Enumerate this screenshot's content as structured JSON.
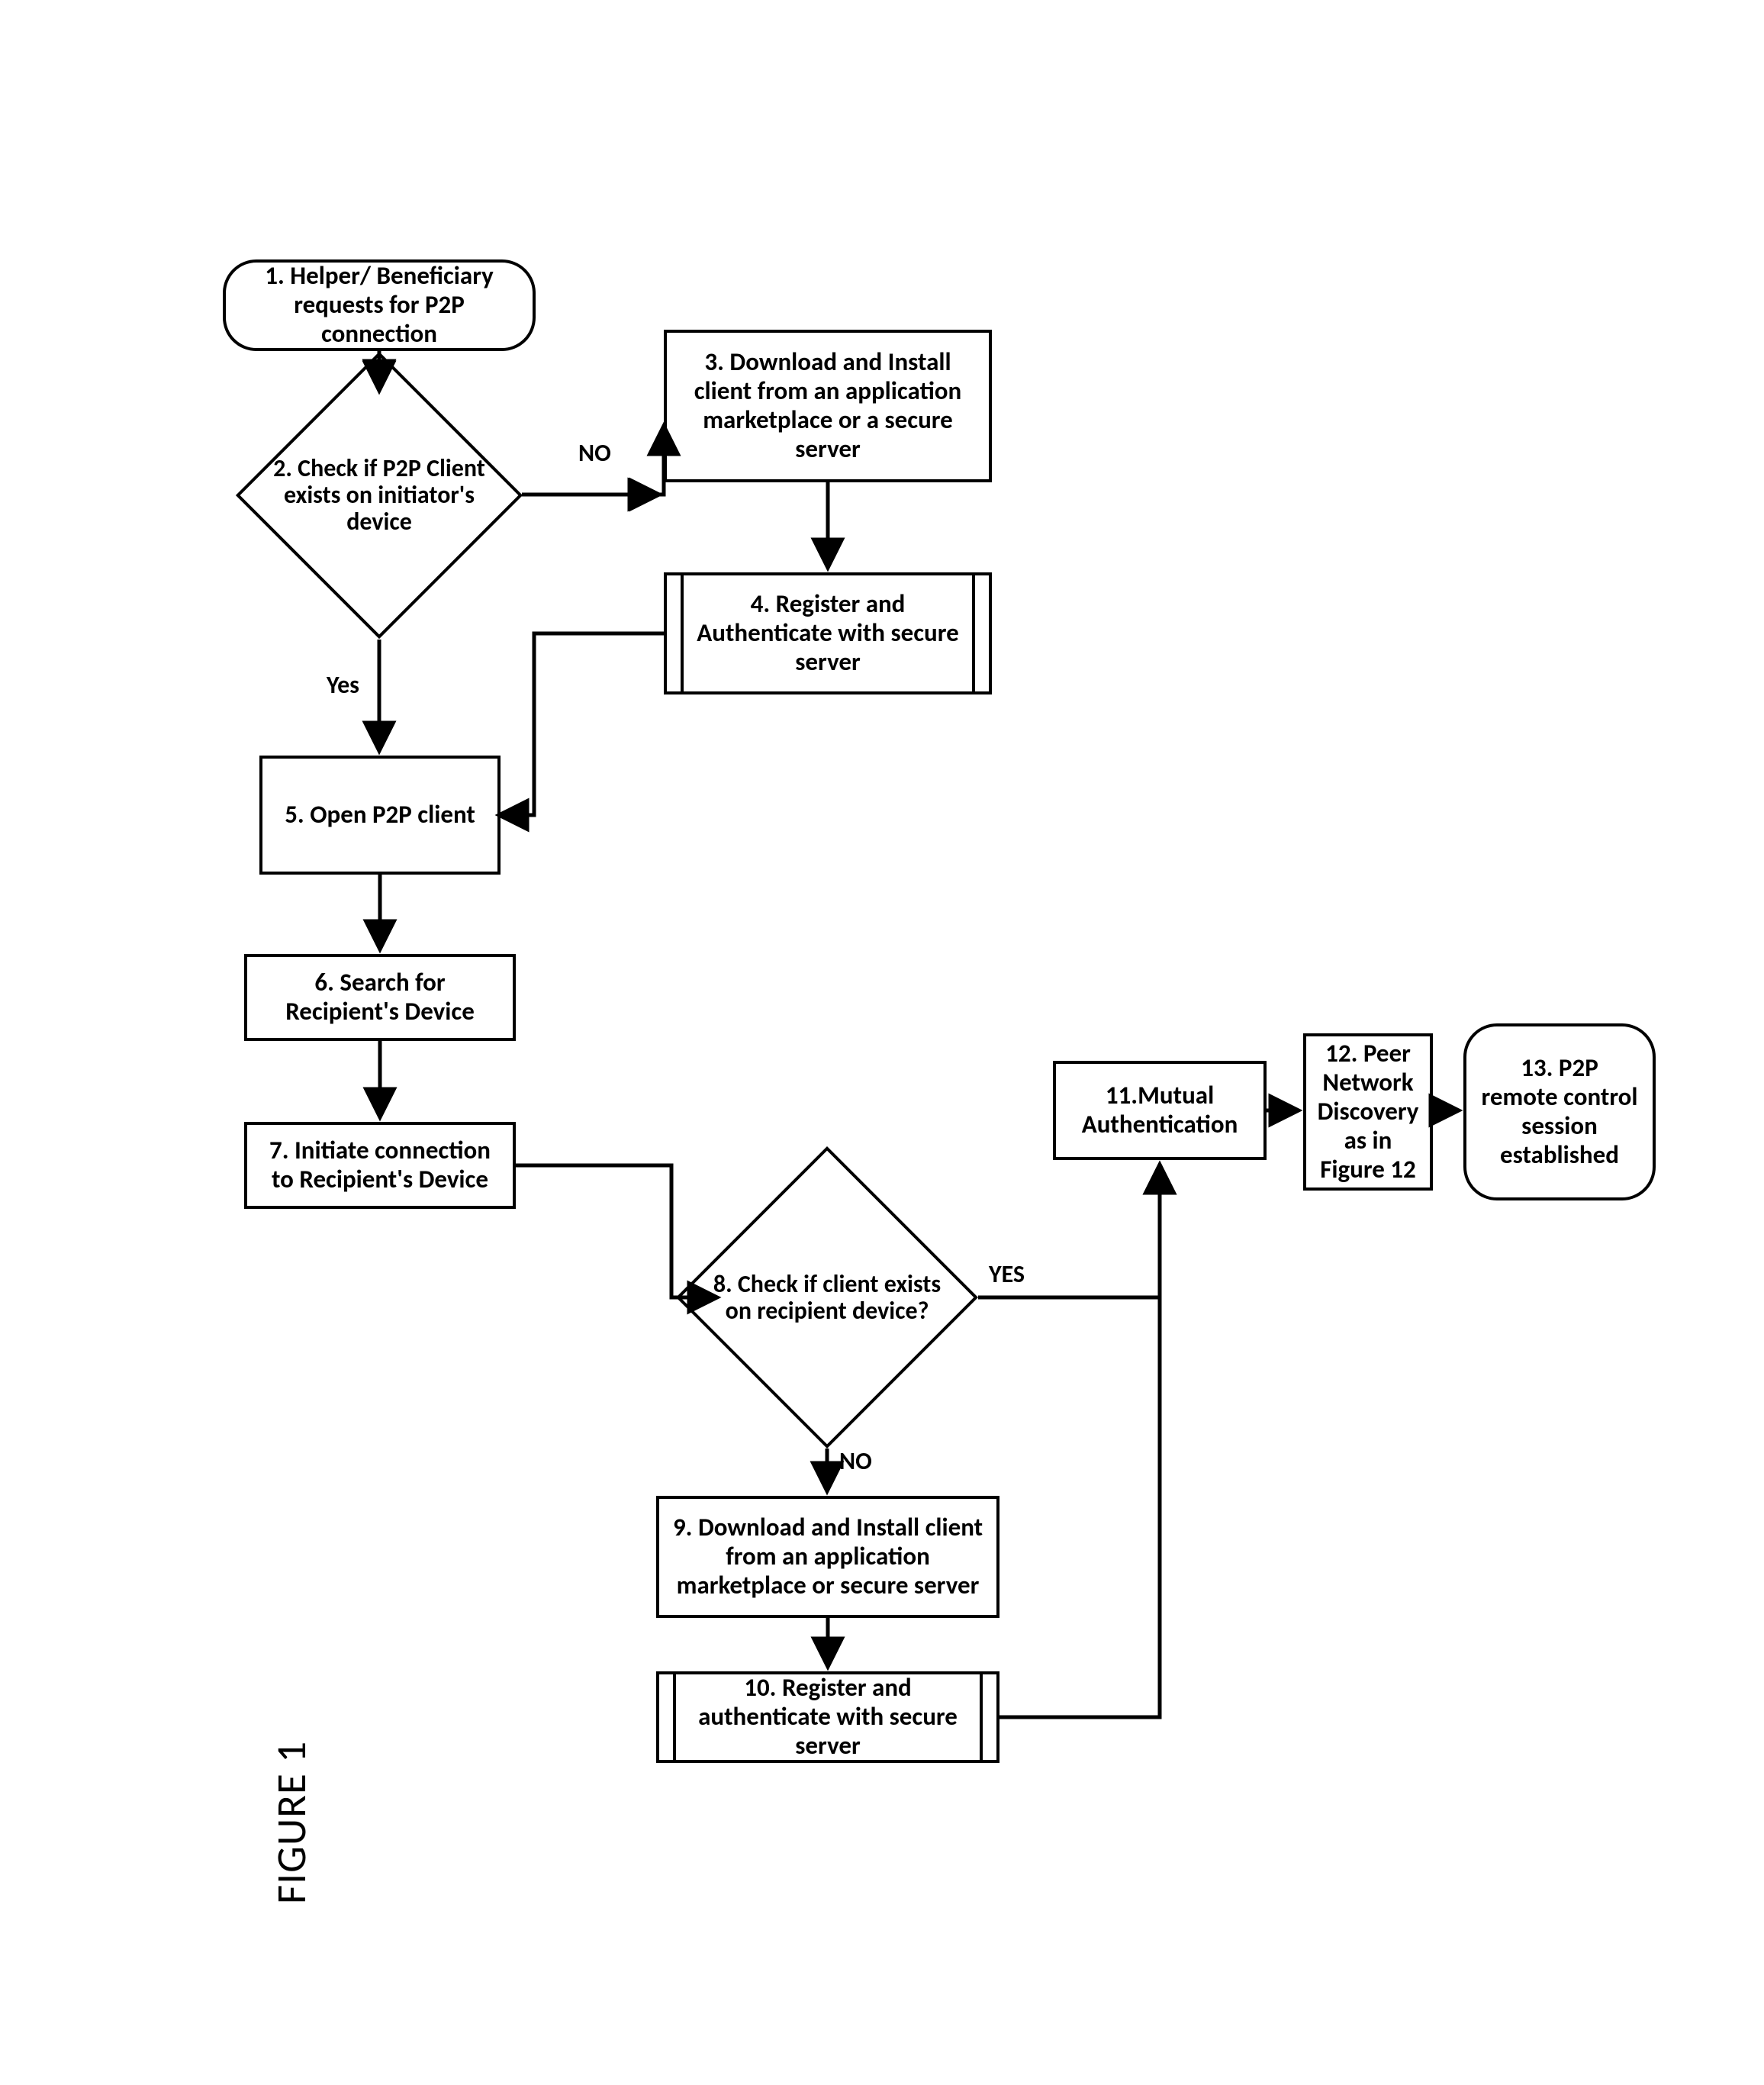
{
  "figure_label": "FIGURE 1",
  "nodes": {
    "n1": "1. Helper/ Beneficiary requests for P2P connection",
    "n2": "2. Check if P2P  Client exists on initiator's device",
    "n3": "3. Download and Install client from an application marketplace or a secure server",
    "n4": "4. Register and Authenticate with secure server",
    "n5": "5. Open P2P client",
    "n6": "6. Search for Recipient's Device",
    "n7": "7. Initiate connection to Recipient's Device",
    "n8": "8. Check if client exists on recipient device?",
    "n9": "9. Download and Install client from an application marketplace or secure server",
    "n10": "10. Register and authenticate with secure server",
    "n11": "11.Mutual Authentication",
    "n12": "12. Peer Network Discovery as in Figure 12",
    "n13": "13. P2P remote control session established"
  },
  "edges": {
    "no1": "NO",
    "yes1": "Yes",
    "yes2": "YES",
    "no2": "NO"
  }
}
